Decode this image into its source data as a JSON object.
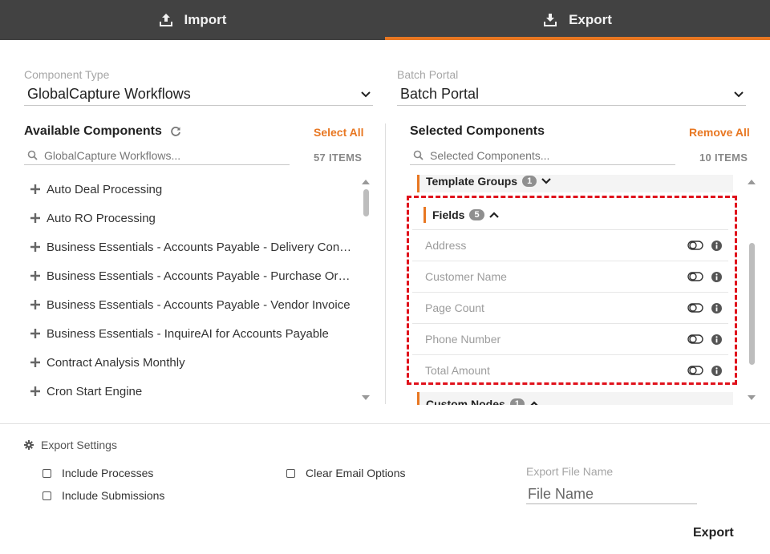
{
  "tabs": [
    {
      "label": "Import",
      "icon": "upload-icon",
      "active": false
    },
    {
      "label": "Export",
      "icon": "download-icon",
      "active": true
    }
  ],
  "accent_color": "#e87722",
  "component_type": {
    "label": "Component Type",
    "value": "GlobalCapture Workflows"
  },
  "batch_portal": {
    "label": "Batch Portal",
    "value": "Batch Portal"
  },
  "available": {
    "title": "Available Components",
    "select_all": "Select All",
    "search_placeholder": "GlobalCapture Workflows...",
    "count": "57 ITEMS",
    "items": [
      "Auto Deal Processing",
      "Auto RO Processing",
      "Business Essentials - Accounts Payable - Delivery Confirmation",
      "Business Essentials - Accounts Payable - Purchase Order",
      "Business Essentials - Accounts Payable - Vendor Invoice",
      "Business Essentials - InquireAI for Accounts Payable",
      "Contract Analysis Monthly",
      "Cron Start Engine"
    ]
  },
  "selected": {
    "title": "Selected Components",
    "remove_all": "Remove All",
    "search_placeholder": "Selected Components...",
    "count": "10 ITEMS",
    "template_groups": {
      "label": "Template Groups",
      "count": "1"
    },
    "fields": {
      "label": "Fields",
      "count": "5",
      "items": [
        "Address",
        "Customer Name",
        "Page Count",
        "Phone Number",
        "Total Amount"
      ]
    },
    "custom_nodes": {
      "label": "Custom Nodes",
      "count": "1"
    }
  },
  "export_settings": {
    "title": "Export Settings",
    "include_processes": "Include Processes",
    "include_submissions": "Include Submissions",
    "clear_email_options": "Clear Email Options",
    "file_name_label": "Export File Name",
    "file_name_placeholder": "File Name",
    "export_button": "Export"
  }
}
